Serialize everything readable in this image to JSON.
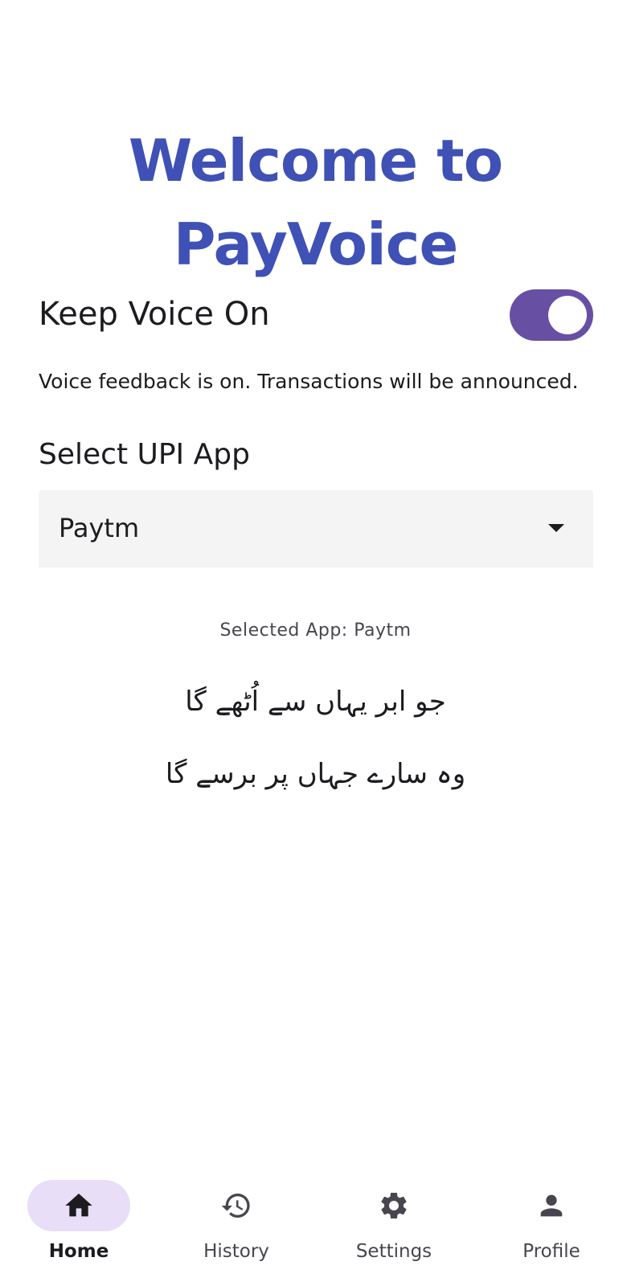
{
  "header": {
    "title_line1": "Welcome to",
    "title_line2": "PayVoice"
  },
  "voice": {
    "label": "Keep Voice On",
    "enabled": true,
    "description": "Voice feedback is on. Transactions will be announced."
  },
  "upi": {
    "section_title": "Select UPI App",
    "selected_value": "Paytm",
    "selected_text": "Selected App: Paytm"
  },
  "poem": {
    "line1": "جو ابر یہاں سے اُٹھے گا",
    "line2": "وہ سارے جہاں پر برسے گا"
  },
  "nav": {
    "items": [
      {
        "label": "Home",
        "icon": "home-icon",
        "active": true
      },
      {
        "label": "History",
        "icon": "history-icon",
        "active": false
      },
      {
        "label": "Settings",
        "icon": "gear-icon",
        "active": false
      },
      {
        "label": "Profile",
        "icon": "person-icon",
        "active": false
      }
    ]
  },
  "colors": {
    "title": "#3f51b5",
    "switch_track": "#6750a4",
    "nav_active_pill": "#e8def8",
    "dropdown_bg": "#f4f4f4"
  }
}
